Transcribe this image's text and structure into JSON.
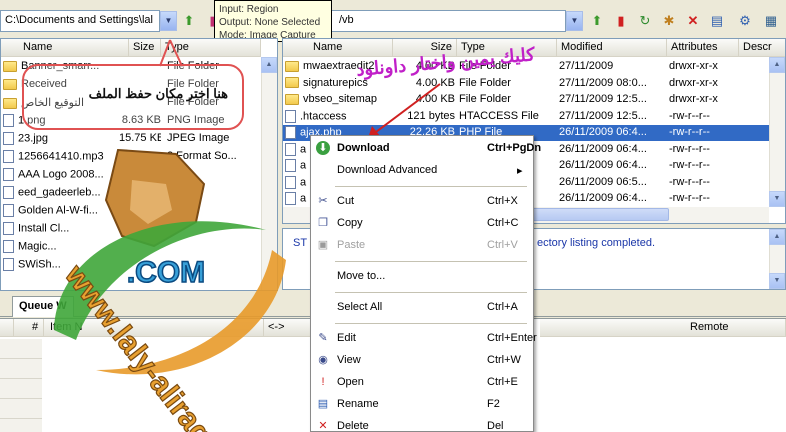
{
  "local_path": "C:\\Documents and Settings\\lal",
  "remote_path": "/vb",
  "tooltip": [
    "Input: Region",
    "Output: None Selected",
    "Mode: Image Capture"
  ],
  "local_headers": {
    "name": "Name",
    "size": "Size",
    "type": "Type"
  },
  "local_rows": [
    {
      "name": "Banner_smarr...",
      "size": "",
      "type": "File Folder",
      "icon": "folder"
    },
    {
      "name": "Received",
      "size": "",
      "type": "File Folder",
      "icon": "folder"
    },
    {
      "name": "التوقيع الخاص",
      "size": "",
      "type": "File Folder",
      "icon": "folder"
    },
    {
      "name": "1.png",
      "size": "8.63 KB",
      "type": "PNG Image",
      "icon": "file"
    },
    {
      "name": "23.jpg",
      "size": "15.75 KB",
      "type": "JPEG Image",
      "icon": "file"
    },
    {
      "name": "1256641410.mp3",
      "size": "",
      "type": "3 Format So...",
      "icon": "file"
    },
    {
      "name": "AAA Logo 2008...",
      "size": "",
      "type": "",
      "icon": "file"
    },
    {
      "name": "eed_gadeerleb...",
      "size": "",
      "type": "",
      "icon": "file"
    },
    {
      "name": "Golden Al-W-fi...",
      "size": "",
      "type": "",
      "icon": "file"
    },
    {
      "name": "Install Cl...",
      "size": "",
      "type": "t",
      "icon": "file"
    },
    {
      "name": "Magic...",
      "size": "",
      "type": "",
      "icon": "file"
    },
    {
      "name": "SWiSh...",
      "size": "",
      "type": "",
      "icon": "file"
    }
  ],
  "remote_headers": {
    "name": "Name",
    "size": "Size",
    "type": "Type",
    "modified": "Modified",
    "attributes": "Attributes",
    "desc": "Descr"
  },
  "remote_rows": [
    {
      "name": "mwaextraedit2",
      "size": "4.00 KB",
      "type": "File Folder",
      "modified": "27/11/2009",
      "attr": "drwxr-xr-x",
      "icon": "folder"
    },
    {
      "name": "signaturepics",
      "size": "4.00 KB",
      "type": "File Folder",
      "modified": "27/11/2009 08:0...",
      "attr": "drwxr-xr-x",
      "icon": "folder"
    },
    {
      "name": "vbseo_sitemap",
      "size": "4.00 KB",
      "type": "File Folder",
      "modified": "27/11/2009 12:5...",
      "attr": "drwxr-xr-x",
      "icon": "folder"
    },
    {
      "name": ".htaccess",
      "size": "121 bytes",
      "type": "HTACCESS File",
      "modified": "27/11/2009 12:5...",
      "attr": "-rw-r--r--",
      "icon": "file"
    },
    {
      "name": "ajax.php",
      "size": "22.26 KB",
      "type": "PHP File",
      "modified": "26/11/2009 06:4...",
      "attr": "-rw-r--r--",
      "icon": "file"
    },
    {
      "name": "a",
      "size": "",
      "type": "",
      "modified": "26/11/2009 06:4...",
      "attr": "-rw-r--r--",
      "icon": "file"
    },
    {
      "name": "a",
      "size": "",
      "type": "",
      "modified": "26/11/2009 06:4...",
      "attr": "-rw-r--r--",
      "icon": "file"
    },
    {
      "name": "a",
      "size": "",
      "type": "",
      "modified": "26/11/2009 06:5...",
      "attr": "-rw-r--r--",
      "icon": "file"
    },
    {
      "name": "a",
      "size": "",
      "type": "",
      "modified": "26/11/2009 06:4...",
      "attr": "-rw-r--r--",
      "icon": "file"
    }
  ],
  "status": {
    "prefix": "ST",
    "message": "ectory listing completed."
  },
  "queue": {
    "tab": "Queue W",
    "col_num": "#",
    "col_item": "Item N",
    "col_dir": "<->",
    "col_remote": "Remote"
  },
  "context_menu": [
    {
      "label": "Download",
      "shortcut": "Ctrl+PgDn",
      "icon": "download-icon",
      "bold": true,
      "disabled": false
    },
    {
      "label": "Download Advanced",
      "shortcut": "▸",
      "icon": "",
      "bold": false,
      "disabled": false
    },
    {
      "sep": true
    },
    {
      "label": "Cut",
      "shortcut": "Ctrl+X",
      "icon": "scissors-icon",
      "bold": false,
      "disabled": false
    },
    {
      "label": "Copy",
      "shortcut": "Ctrl+C",
      "icon": "copy-icon",
      "bold": false,
      "disabled": false
    },
    {
      "label": "Paste",
      "shortcut": "Ctrl+V",
      "icon": "paste-icon",
      "bold": false,
      "disabled": true
    },
    {
      "sep": true
    },
    {
      "label": "Move to...",
      "shortcut": "",
      "icon": "",
      "bold": false,
      "disabled": false
    },
    {
      "sep": true
    },
    {
      "label": "Select All",
      "shortcut": "Ctrl+A",
      "icon": "",
      "bold": false,
      "disabled": false
    },
    {
      "sep": true
    },
    {
      "label": "Edit",
      "shortcut": "Ctrl+Enter",
      "icon": "edit-icon",
      "bold": false,
      "disabled": false
    },
    {
      "label": "View",
      "shortcut": "Ctrl+W",
      "icon": "view-icon",
      "bold": false,
      "disabled": false
    },
    {
      "label": "Open",
      "shortcut": "Ctrl+E",
      "icon": "open-icon",
      "bold": false,
      "disabled": false
    },
    {
      "label": "Rename",
      "shortcut": "F2",
      "icon": "rename-icon",
      "bold": false,
      "disabled": false
    },
    {
      "label": "Delete",
      "shortcut": "Del",
      "icon": "delete-icon",
      "bold": false,
      "disabled": false
    }
  ],
  "annotation_local": "هنا اختر مكان حفظ الملف",
  "annotation_remote": "كليك يمين واختار داونلود",
  "logo": {
    "domain": ".COM",
    "url": "www.laly-aliraq"
  },
  "colors": {
    "selection": "#316ac5",
    "annotation_red": "#e05252",
    "annotation_purple": "#c020c8",
    "logo_green": "#3fa63a",
    "logo_orange": "#e89a2a"
  }
}
